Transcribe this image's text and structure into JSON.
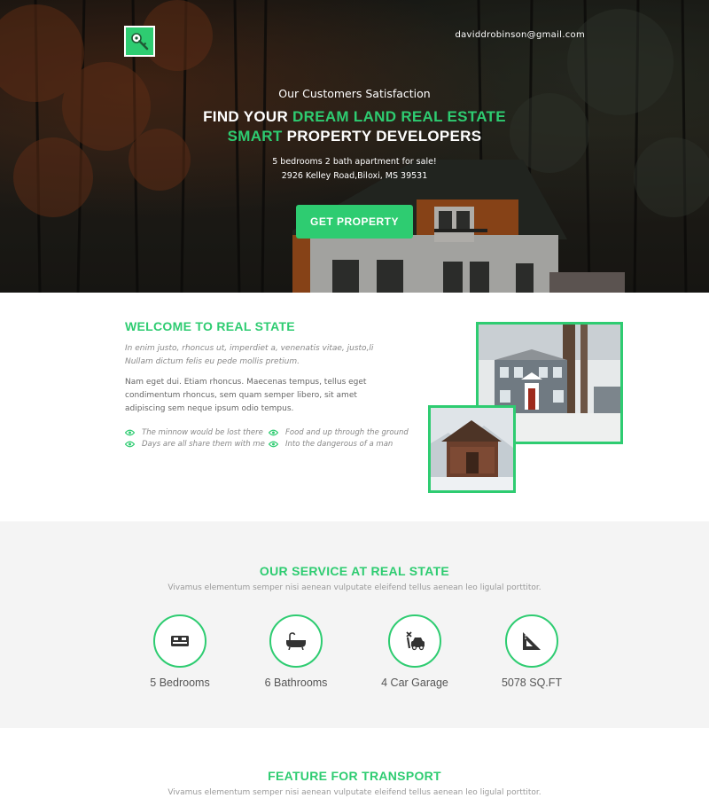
{
  "header": {
    "logo_icon": "key-icon",
    "email": "daviddrobinson@gmail.com"
  },
  "hero": {
    "subtitle": "Our Customers Satisfaction",
    "title_part1": "FIND YOUR ",
    "title_part2": "DREAM LAND REAL ESTATE",
    "title_part3": "SMART",
    "title_part4": " PROPERTY DEVELOPERS",
    "desc_line1": "5 bedrooms 2 bath apartment for sale!",
    "desc_line2": "2926 Kelley Road,Biloxi, MS 39531",
    "cta_label": "GET PROPERTY"
  },
  "welcome": {
    "title": "WELCOME TO REAL STATE",
    "italic_line1": "In enim justo, rhoncus ut, imperdiet a, venenatis vitae, justo,li",
    "italic_line2": "Nullam dictum felis eu pede mollis pretium.",
    "body_line1": "Nam eget dui. Etiam rhoncus. Maecenas tempus, tellus eget",
    "body_line2": "condimentum rhoncus, sem quam semper libero, sit amet",
    "body_line3": "adipiscing sem neque ipsum odio tempus.",
    "checks": [
      "The minnow would be lost there",
      "Food and up through the ground",
      "Days are all share them with me",
      "Into the dangerous of a man"
    ]
  },
  "services": {
    "title": "OUR SERVICE AT REAL STATE",
    "subtitle": "Vivamus elementum semper nisi aenean vulputate eleifend tellus aenean leo ligulal porttitor.",
    "items": [
      {
        "icon": "bed-icon",
        "label": "5 Bedrooms"
      },
      {
        "icon": "bathtub-icon",
        "label": "6 Bathrooms"
      },
      {
        "icon": "car-wrench-icon",
        "label": "4 Car Garage"
      },
      {
        "icon": "set-square-icon",
        "label": "5078 SQ.FT"
      }
    ]
  },
  "feature": {
    "title": "FEATURE FOR TRANSPORT",
    "subtitle": "Vivamus elementum semper nisi aenean vulputate eleifend tellus aenean leo ligulal porttitor."
  },
  "colors": {
    "accent": "#2ecc71",
    "hero_dark": "#1e1d19",
    "section_gray": "#f4f4f4"
  }
}
